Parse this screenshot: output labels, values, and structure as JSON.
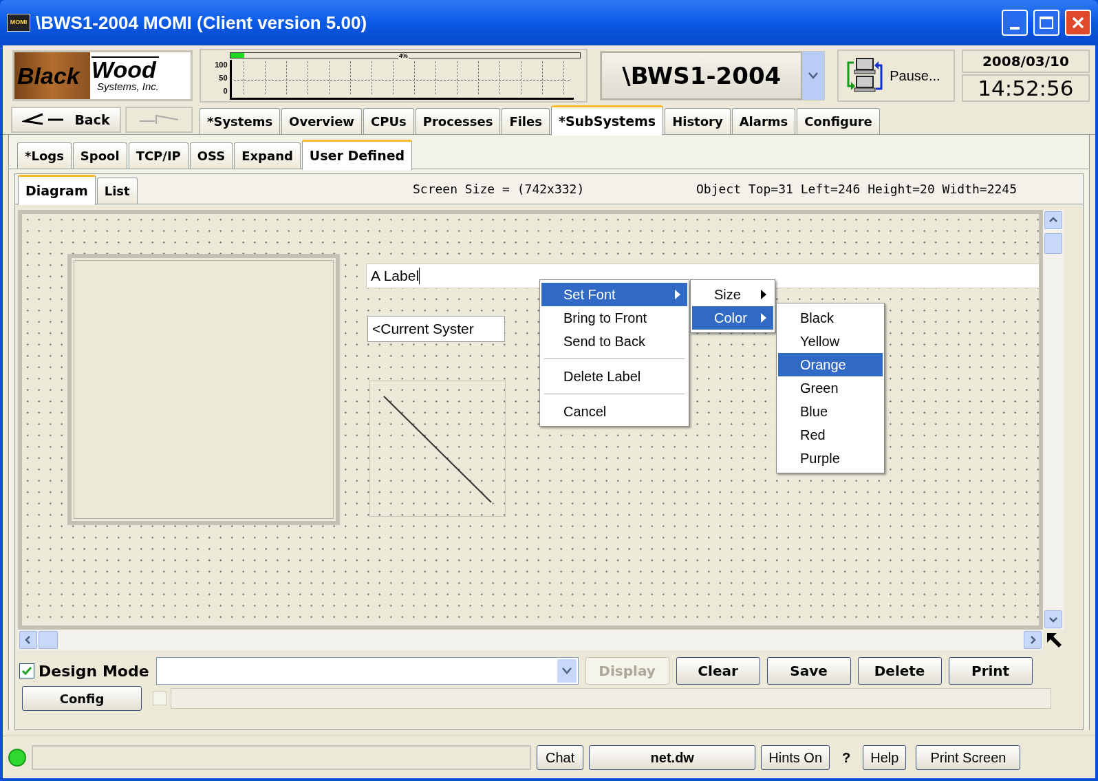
{
  "window": {
    "title": "\\BWS1-2004 MOMI (Client version 5.00)",
    "icon_text": "MOMI"
  },
  "logo": {
    "word1": "Black",
    "word2": "Wood",
    "tagline": "Systems, Inc."
  },
  "cpu_meter": {
    "label": "4%",
    "level": 0.04,
    "scale_labels": [
      "100",
      "50",
      "0"
    ]
  },
  "system_selector": {
    "value": "\\BWS1-2004"
  },
  "pause": {
    "label": "Pause..."
  },
  "date": "2008/03/10",
  "time": "14:52:56",
  "back_button": {
    "label": "Back"
  },
  "main_tabs": [
    {
      "label": "*Systems",
      "selected": false
    },
    {
      "label": "Overview",
      "selected": false
    },
    {
      "label": "CPUs",
      "selected": false
    },
    {
      "label": "Processes",
      "selected": false
    },
    {
      "label": "Files",
      "selected": false
    },
    {
      "label": "*SubSystems",
      "selected": true
    },
    {
      "label": "History",
      "selected": false
    },
    {
      "label": "Alarms",
      "selected": false
    },
    {
      "label": "Configure",
      "selected": false
    }
  ],
  "sub_tabs": [
    {
      "label": "*Logs",
      "selected": false
    },
    {
      "label": "Spool",
      "selected": false
    },
    {
      "label": "TCP/IP",
      "selected": false
    },
    {
      "label": "OSS",
      "selected": false
    },
    {
      "label": "Expand",
      "selected": false
    },
    {
      "label": "User Defined",
      "selected": true
    }
  ],
  "view_tabs": [
    {
      "label": "Diagram",
      "selected": true
    },
    {
      "label": "List",
      "selected": false
    }
  ],
  "screen_size": "Screen Size = (742x332)",
  "object_info": "Object Top=31 Left=246 Height=20 Width=2245",
  "canvas": {
    "objects": [
      {
        "kind": "frame"
      },
      {
        "kind": "field",
        "text": "A Label"
      },
      {
        "kind": "text",
        "text": "<Current Syster"
      },
      {
        "kind": "line"
      }
    ]
  },
  "context_menu": {
    "items": [
      {
        "kind": "submenu",
        "label": "Set Font",
        "selected": true
      },
      {
        "kind": "item",
        "label": "Bring to Front",
        "selected": false
      },
      {
        "kind": "item",
        "label": "Send to Back",
        "selected": false
      },
      {
        "kind": "separator"
      },
      {
        "kind": "item",
        "label": "Delete Label",
        "selected": false
      },
      {
        "kind": "separator"
      },
      {
        "kind": "item",
        "label": "Cancel",
        "selected": false
      }
    ]
  },
  "font_menu": {
    "items": [
      {
        "kind": "submenu",
        "label": "Size",
        "selected": false
      },
      {
        "kind": "submenu",
        "label": "Color",
        "selected": true
      }
    ]
  },
  "color_menu": {
    "items": [
      {
        "label": "Black",
        "selected": false
      },
      {
        "label": "Yellow",
        "selected": false
      },
      {
        "label": "Orange",
        "selected": true
      },
      {
        "label": "Green",
        "selected": false
      },
      {
        "label": "Blue",
        "selected": false
      },
      {
        "label": "Red",
        "selected": false
      },
      {
        "label": "Purple",
        "selected": false
      }
    ]
  },
  "design_mode": {
    "label": "Design Mode",
    "checked": true
  },
  "buttons": [
    {
      "label": "Display",
      "disabled": true
    },
    {
      "label": "Clear",
      "disabled": false
    },
    {
      "label": "Save",
      "disabled": false
    },
    {
      "label": "Delete",
      "disabled": false
    },
    {
      "label": "Print",
      "disabled": false
    }
  ],
  "config_button": {
    "label": "Config"
  },
  "option_checkbox": {
    "checked": false
  },
  "status_bar": {
    "online": true,
    "chat": "Chat",
    "file": "net.dw",
    "hints": "Hints On",
    "question": "?",
    "help": "Help",
    "print_screen": "Print Screen"
  }
}
